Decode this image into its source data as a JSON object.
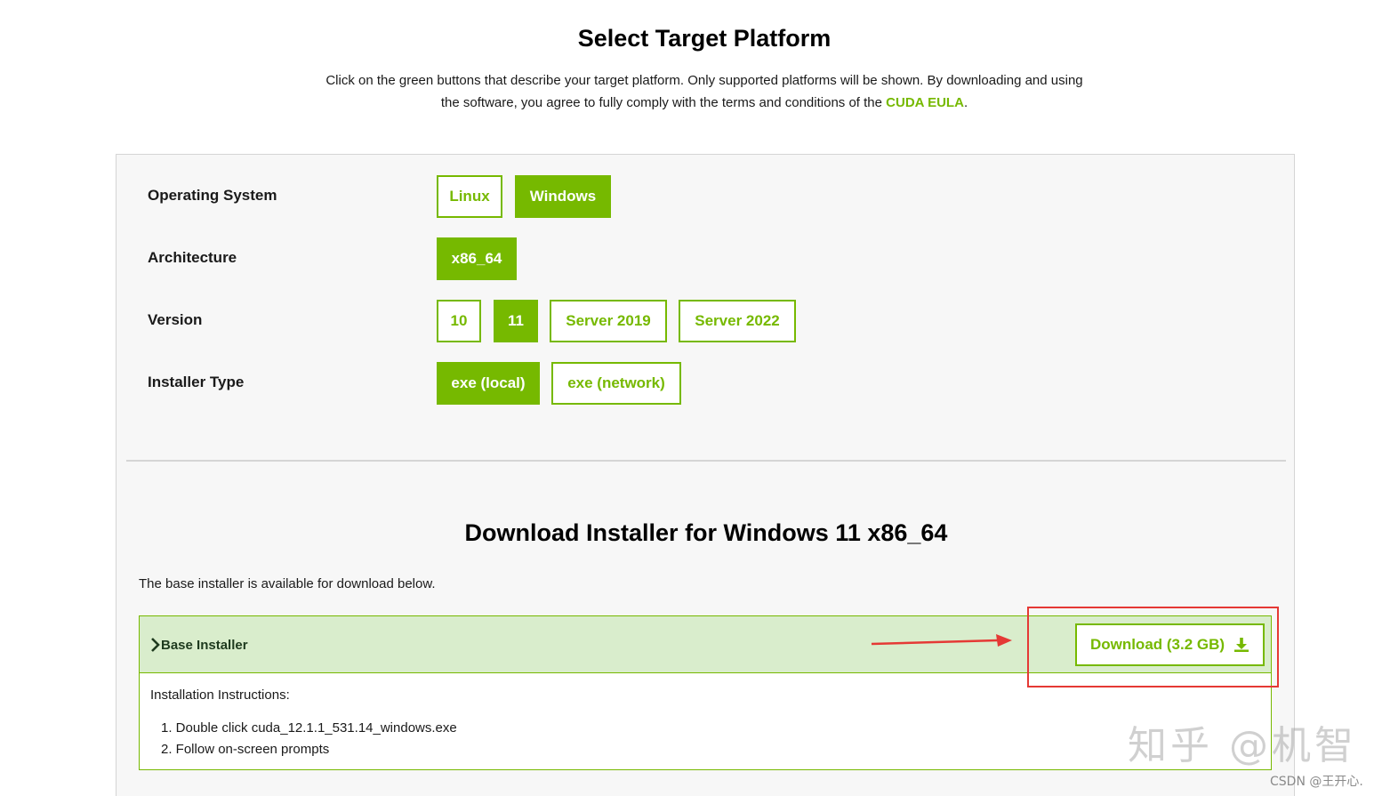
{
  "header": {
    "title": "Select Target Platform",
    "intro_text": "Click on the green buttons that describe your target platform. Only supported platforms will be shown. By downloading and using the software, you agree to fully comply with the terms and conditions of the ",
    "eula_link": "CUDA EULA",
    "intro_end": "."
  },
  "selector": {
    "rows": [
      {
        "label": "Operating System",
        "options": [
          {
            "label": "Linux",
            "selected": false
          },
          {
            "label": "Windows",
            "selected": true
          }
        ]
      },
      {
        "label": "Architecture",
        "options": [
          {
            "label": "x86_64",
            "selected": true
          }
        ]
      },
      {
        "label": "Version",
        "options": [
          {
            "label": "10",
            "selected": false
          },
          {
            "label": "11",
            "selected": true
          },
          {
            "label": "Server 2019",
            "selected": false
          },
          {
            "label": "Server 2022",
            "selected": false
          }
        ]
      },
      {
        "label": "Installer Type",
        "options": [
          {
            "label": "exe (local)",
            "selected": true
          },
          {
            "label": "exe (network)",
            "selected": false
          }
        ]
      }
    ]
  },
  "download": {
    "title": "Download Installer for Windows 11 x86_64",
    "intro": "The base installer is available for download below.",
    "installer": {
      "title": "Base Installer",
      "button_label": "Download (3.2 GB)",
      "instructions_label": "Installation Instructions:",
      "steps": [
        "1. Double click cuda_12.1.1_531.14_windows.exe",
        "2. Follow on-screen prompts"
      ]
    }
  },
  "overlay": {
    "watermark": "知乎 @机智",
    "credit": "CSDN @王开心."
  },
  "colors": {
    "accent": "#76b900",
    "annotation": "#e53935",
    "installer_header_bg": "#d9edcc"
  },
  "icons": {
    "chevron": "chevron-right-icon",
    "download": "download-icon"
  }
}
